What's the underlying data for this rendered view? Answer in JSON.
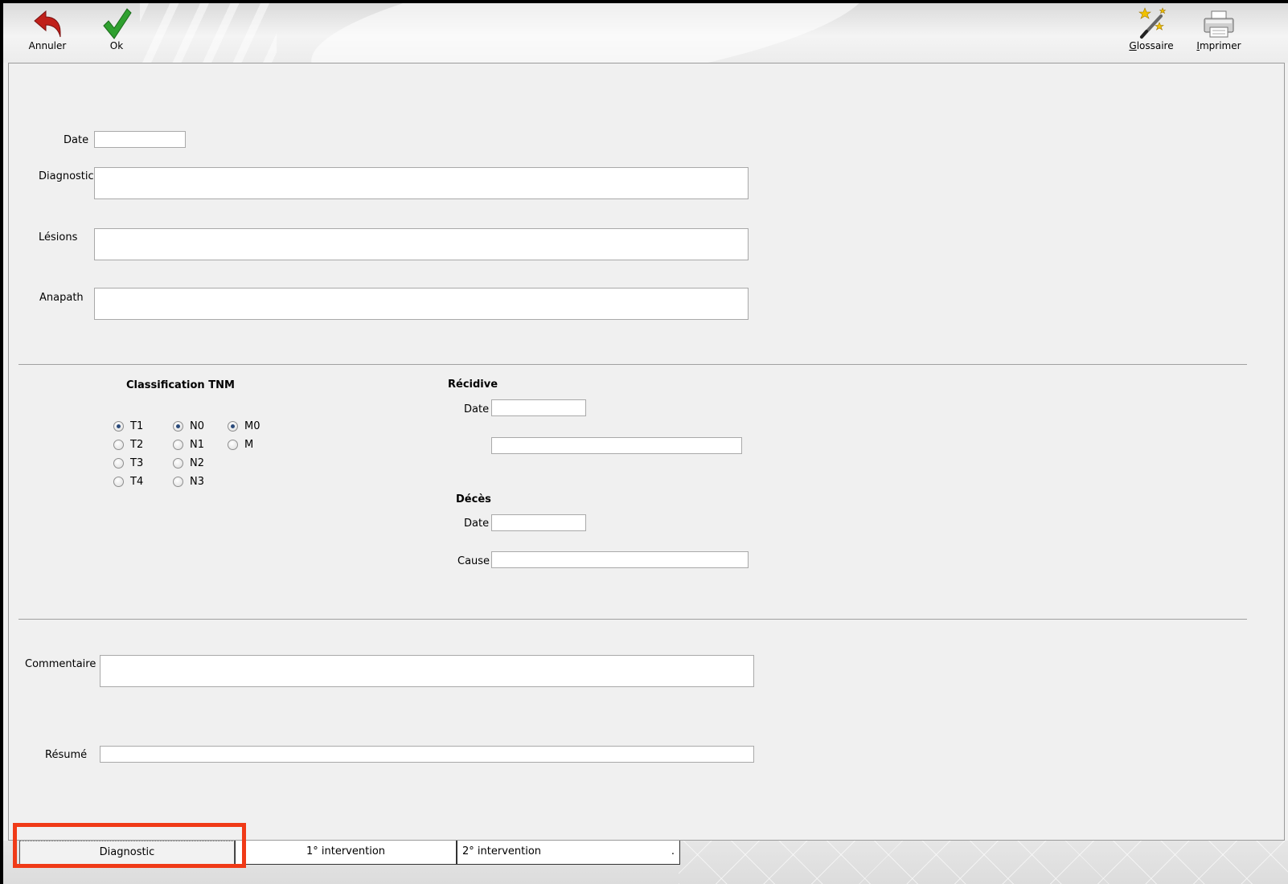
{
  "toolbar": {
    "cancel_label": "Annuler",
    "ok_label": "Ok",
    "glossary_label_first": "G",
    "glossary_label_rest": "lossaire",
    "print_label_first": "I",
    "print_label_rest": "mprimer"
  },
  "form": {
    "date_label": "Date",
    "date_value": "",
    "diagnostic_label": "Diagnostic",
    "diagnostic_value": "",
    "lesions_label": "Lésions",
    "lesions_value": "",
    "anapath_label": "Anapath",
    "anapath_value": ""
  },
  "tnm": {
    "title": "Classification TNM",
    "t_options": [
      "T1",
      "T2",
      "T3",
      "T4"
    ],
    "t_selected": "T1",
    "n_options": [
      "N0",
      "N1",
      "N2",
      "N3"
    ],
    "n_selected": "N0",
    "m_options": [
      "M0",
      "M"
    ],
    "m_selected": "M0"
  },
  "recidive": {
    "title": "Récidive",
    "date_label": "Date",
    "date_value": "",
    "detail_value": ""
  },
  "deces": {
    "title": "Décès",
    "date_label": "Date",
    "date_value": "",
    "cause_label": "Cause",
    "cause_value": ""
  },
  "bottom": {
    "commentaire_label": "Commentaire",
    "commentaire_value": "",
    "resume_label": "Résumé",
    "resume_value": ""
  },
  "tabs": [
    {
      "label": "Diagnostic",
      "active": true
    },
    {
      "label": "1° intervention",
      "active": false
    },
    {
      "label": "2° intervention",
      "active": false
    }
  ],
  "tab3_dot": ".",
  "colors": {
    "highlight": "#f03a17",
    "undo_arrow": "#c0201a",
    "ok_check": "#2fa02f"
  }
}
